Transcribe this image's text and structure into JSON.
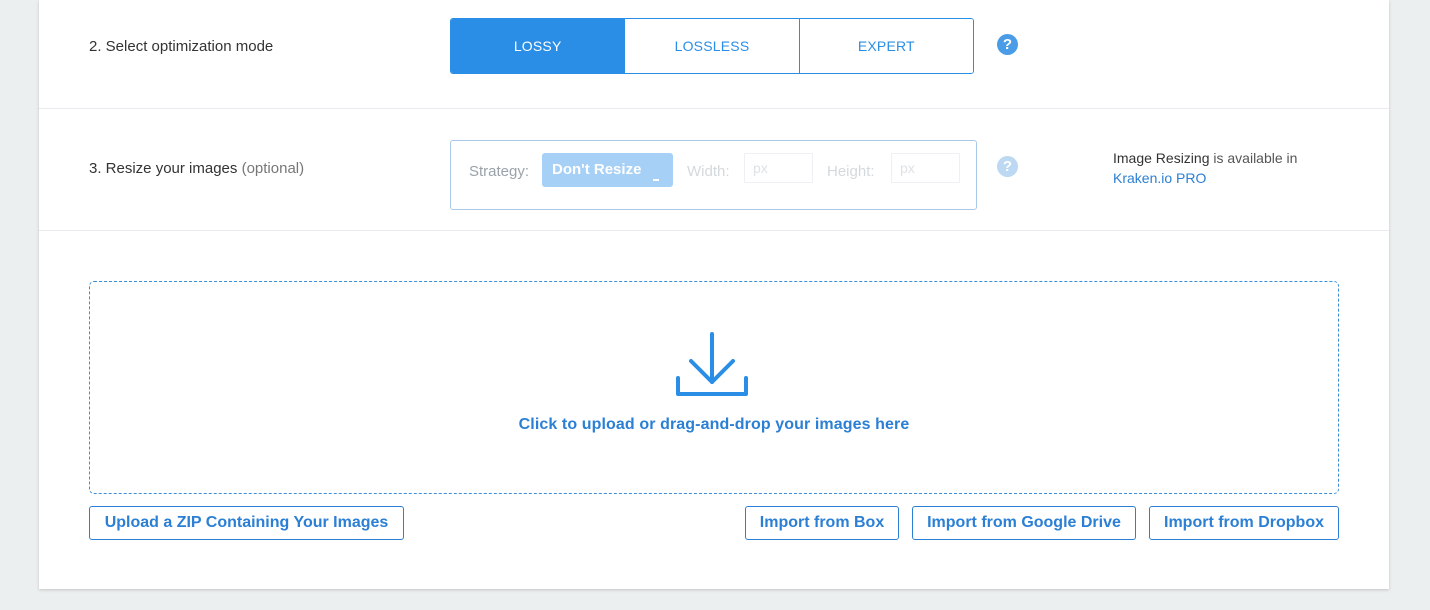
{
  "steps": {
    "mode": {
      "label": "2. Select optimization mode",
      "options": [
        "LOSSY",
        "LOSSLESS",
        "EXPERT"
      ],
      "selected": "LOSSY",
      "help_glyph": "?"
    },
    "resize": {
      "label": "3. Resize your images",
      "optional": "(optional)",
      "strategy_label": "Strategy:",
      "strategy_value": "Don't Resize",
      "width_label": "Width:",
      "width_placeholder": "px",
      "height_label": "Height:",
      "height_placeholder": "px",
      "help_glyph": "?",
      "pro_note": {
        "strong": "Image Resizing",
        "text": " is available in",
        "link": "Kraken.io PRO"
      }
    }
  },
  "upload": {
    "icon": "download-tray-icon",
    "drop_text": "Click to upload or drag-and-drop your images here",
    "zip_button": "Upload a ZIP Containing Your Images",
    "import_buttons": [
      "Import from Box",
      "Import from Google Drive",
      "Import from Dropbox"
    ]
  },
  "colors": {
    "accent": "#2b8ee6",
    "link": "#2b7fd4",
    "disabled_select": "#a6d0f6",
    "page_bg": "#eceff0"
  }
}
